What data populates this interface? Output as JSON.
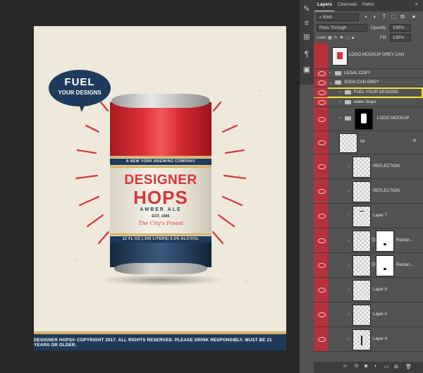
{
  "poster": {
    "bubble_line1": "FUEL",
    "bubble_line2": "YOUR DESIGNS",
    "can_band_top": "A NEW YORK BREWING COMPANY",
    "brand_line1": "DESIGNER",
    "brand_line2": "HOPS",
    "style": "AMBER ALE",
    "est": "EST. 1986",
    "tagline": "The City's Finest",
    "can_band_bottom": "12 FL OZ (.355 LITERS) 6.5% ALC/VOL",
    "footer": "DESIGNER HOPS® COPYRIGHT 2017. ALL RIGHTS RESERVED. PLEASE DRINK RESPONSIBLY. MUST BE 21 YEARS OR OLDER."
  },
  "panel": {
    "tabs": [
      "Layers",
      "Channels",
      "Paths"
    ],
    "filter_kind": "Kind",
    "blend_mode": "Pass Through",
    "opacity_label": "Opacity:",
    "opacity_value": "100%",
    "lock_label": "Lock:",
    "fill_label": "Fill:",
    "fill_value": "100%",
    "fx": "fx"
  },
  "layers": [
    {
      "name": "LOGO MOCKUP GREY CAN",
      "kind": "smart",
      "visible": false
    },
    {
      "name": "LEGAL COPY",
      "kind": "folder",
      "visible": true
    },
    {
      "name": "SODA CAN GREY",
      "kind": "folder-open",
      "visible": true
    },
    {
      "name": "FUEL YOUR DESIGNS",
      "kind": "folder",
      "visible": true,
      "selected": true
    },
    {
      "name": "water drops",
      "kind": "folder",
      "visible": true
    },
    {
      "name": "LOGO MOCKUP",
      "kind": "folder-thumb",
      "visible": true
    },
    {
      "name": "lid",
      "kind": "layer",
      "visible": true
    },
    {
      "name": "REFLECTION",
      "kind": "layer",
      "visible": true
    },
    {
      "name": "REFLECTION",
      "kind": "layer",
      "visible": true
    },
    {
      "name": "Layer 7",
      "kind": "layer",
      "visible": true
    },
    {
      "name": "Rectan...",
      "kind": "mask",
      "visible": true
    },
    {
      "name": "Rectan...",
      "kind": "mask",
      "visible": true
    },
    {
      "name": "Layer 6",
      "kind": "layer",
      "visible": true
    },
    {
      "name": "Layer 5",
      "kind": "layer",
      "visible": true
    },
    {
      "name": "Layer 4",
      "kind": "layer",
      "visible": true
    }
  ]
}
